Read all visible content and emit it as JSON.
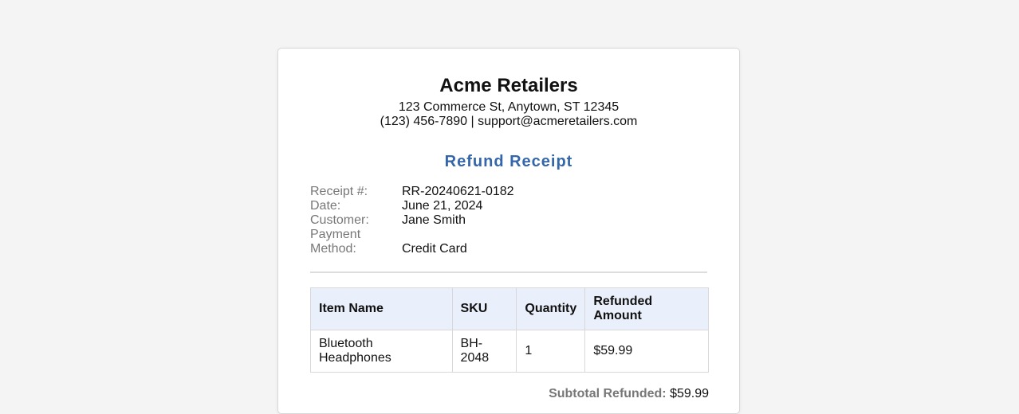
{
  "store": {
    "name": "Acme Retailers",
    "address": "123 Commerce St, Anytown, ST 12345",
    "contact": "(123) 456-7890 | support@acmeretailers.com"
  },
  "document": {
    "title": "Refund Receipt"
  },
  "meta": {
    "receipt_label": "Receipt #:",
    "receipt_value": "RR-20240621-0182",
    "date_label": "Date:",
    "date_value": "June 21, 2024",
    "customer_label": "Customer:",
    "customer_value": "Jane Smith",
    "payment_label": "Payment Method:",
    "payment_value": "Credit Card"
  },
  "table": {
    "headers": [
      "Item Name",
      "SKU",
      "Quantity",
      "Refunded Amount"
    ],
    "rows": [
      [
        "Bluetooth Headphones",
        "BH-2048",
        "1",
        "$59.99"
      ]
    ]
  },
  "summary": {
    "subtotal_label": "Subtotal Refunded:",
    "subtotal_value": "$59.99"
  },
  "colors": {
    "title_accent": "#3366aa",
    "table_header_bg": "#eaf0fb",
    "label_gray": "#777777"
  }
}
